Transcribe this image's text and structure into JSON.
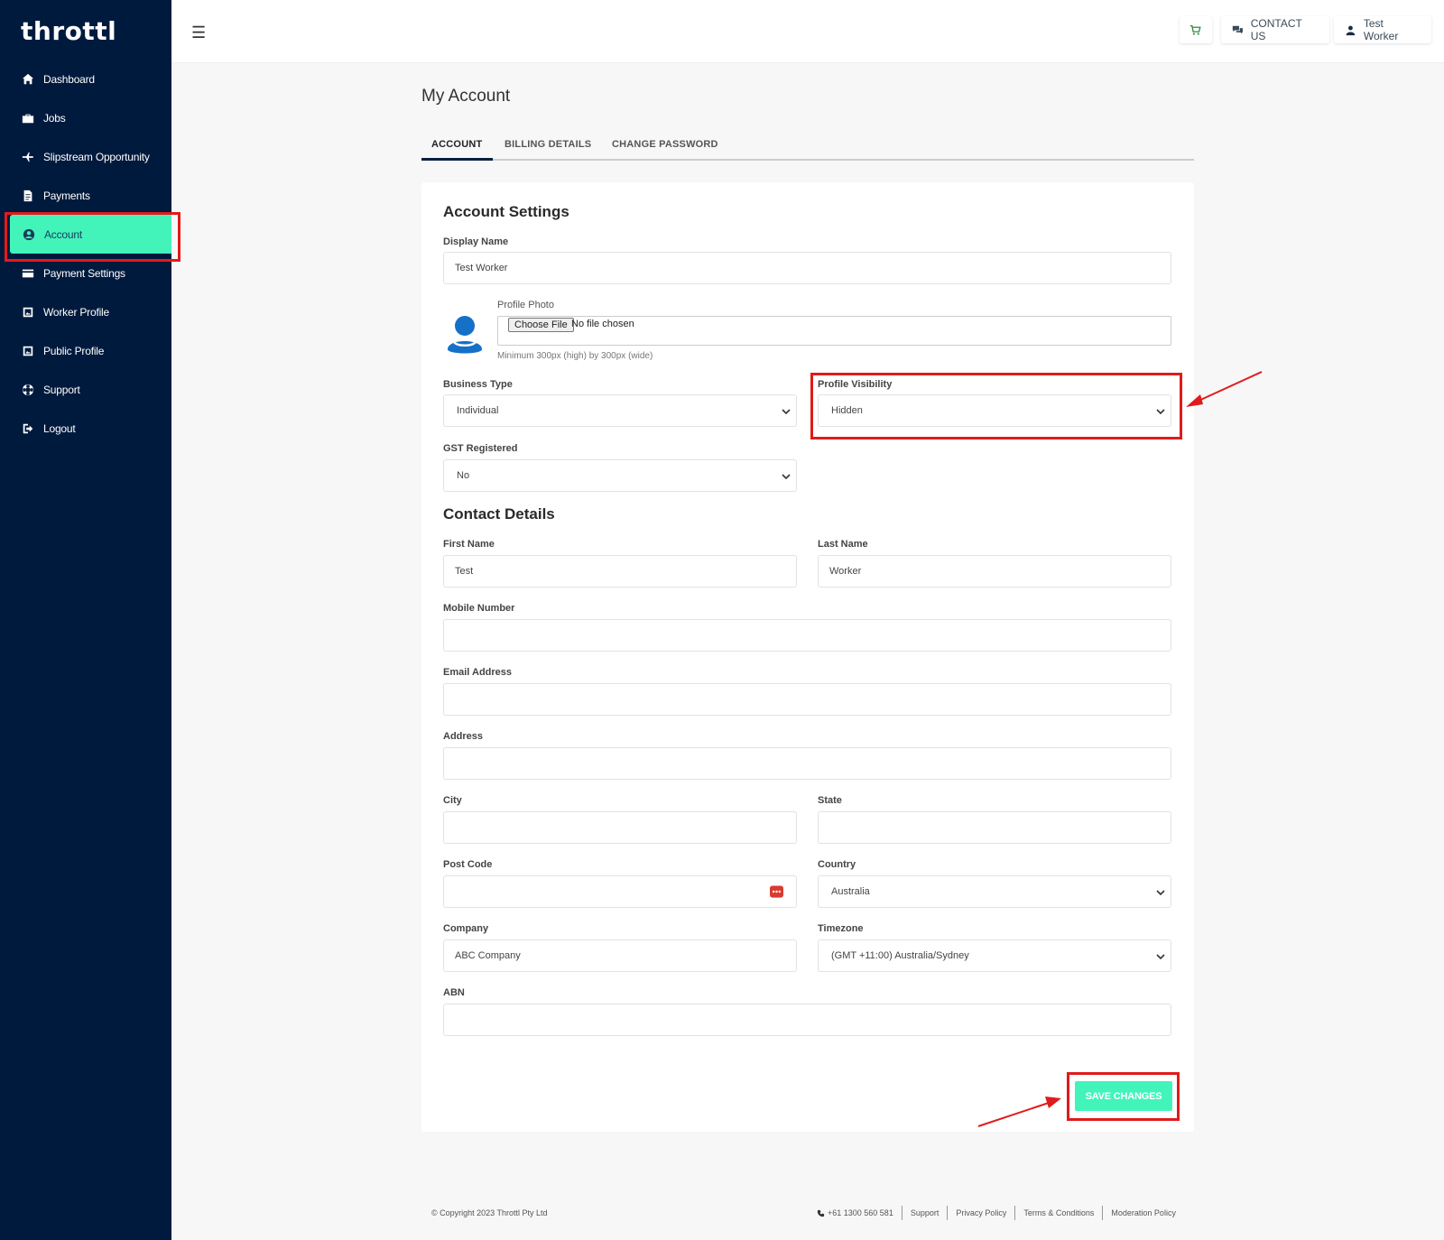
{
  "app": {
    "logo": "throttl"
  },
  "sidebar": {
    "items": [
      {
        "label": "Dashboard",
        "icon": "home-icon"
      },
      {
        "label": "Jobs",
        "icon": "briefcase-icon"
      },
      {
        "label": "Slipstream Opportunity",
        "icon": "plane-icon"
      },
      {
        "label": "Payments",
        "icon": "document-icon"
      },
      {
        "label": "Account",
        "icon": "user-circle-icon",
        "active": true
      },
      {
        "label": "Payment Settings",
        "icon": "credit-card-icon"
      },
      {
        "label": "Worker Profile",
        "icon": "image-icon"
      },
      {
        "label": "Public Profile",
        "icon": "image-icon"
      },
      {
        "label": "Support",
        "icon": "lifebuoy-icon"
      },
      {
        "label": "Logout",
        "icon": "logout-icon"
      }
    ]
  },
  "topbar": {
    "contact_label": "CONTACT US",
    "user_label": "Test Worker"
  },
  "page": {
    "title": "My Account",
    "tabs": [
      "ACCOUNT",
      "BILLING DETAILS",
      "CHANGE PASSWORD"
    ]
  },
  "account": {
    "section_title": "Account Settings",
    "display_name_label": "Display Name",
    "display_name_value": "Test Worker",
    "profile_photo_label": "Profile Photo",
    "choose_file_label": "Choose File",
    "no_file_text": "No file chosen",
    "photo_hint": "Minimum 300px (high) by 300px (wide)",
    "business_type_label": "Business Type",
    "business_type_value": "Individual",
    "profile_visibility_label": "Profile Visibility",
    "profile_visibility_value": "Hidden",
    "gst_label": "GST Registered",
    "gst_value": "No"
  },
  "contact": {
    "section_title": "Contact Details",
    "first_name_label": "First Name",
    "first_name_value": "Test",
    "last_name_label": "Last Name",
    "last_name_value": "Worker",
    "mobile_label": "Mobile Number",
    "mobile_value": "",
    "email_label": "Email Address",
    "email_value": "",
    "address_label": "Address",
    "address_value": "",
    "city_label": "City",
    "city_value": "",
    "state_label": "State",
    "state_value": "",
    "postcode_label": "Post Code",
    "postcode_value": "",
    "country_label": "Country",
    "country_value": "Australia",
    "company_label": "Company",
    "company_value": "ABC Company",
    "timezone_label": "Timezone",
    "timezone_value": "(GMT +11:00) Australia/Sydney",
    "abn_label": "ABN",
    "abn_value": ""
  },
  "actions": {
    "save_label": "SAVE CHANGES"
  },
  "footer": {
    "copyright": "© Copyright 2023 Throttl Pty Ltd",
    "phone": "+61 1300 560 581",
    "links": [
      "Support",
      "Privacy Policy",
      "Terms & Conditions",
      "Moderation Policy"
    ]
  },
  "colors": {
    "sidebar_bg": "#001a3d",
    "accent": "#42f4b9",
    "annotation_red": "#e01b1b"
  }
}
